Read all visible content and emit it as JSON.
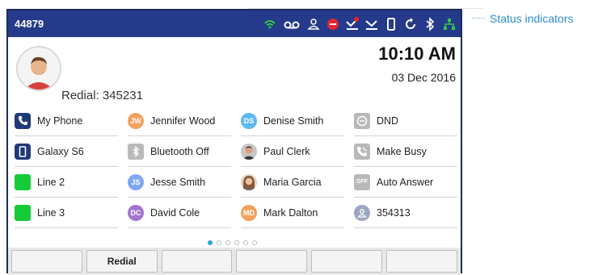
{
  "statusbar": {
    "extension": "44879",
    "icons": [
      "wifi-icon",
      "voicemail-icon",
      "presence-icon",
      "dnd-icon",
      "missed-call-icon",
      "call-forward-icon",
      "handset-icon",
      "sync-icon",
      "bluetooth-icon",
      "network-icon"
    ]
  },
  "home": {
    "redial_label": "Redial: 345231",
    "time": "10:10 AM",
    "date": "03 Dec 2016"
  },
  "keys": [
    {
      "label": "My Phone",
      "icon": "phone-icon",
      "type": "dark"
    },
    {
      "label": "Jennifer Wood",
      "icon": "initials",
      "initials": "JW",
      "color": "#f1a25e",
      "type": "circle"
    },
    {
      "label": "Denise Smith",
      "icon": "initials",
      "initials": "DS",
      "color": "#5fb8ef",
      "type": "circle"
    },
    {
      "label": "DND",
      "icon": "dnd-key-icon",
      "type": "gray"
    },
    {
      "label": "Galaxy S6",
      "icon": "mobile-icon",
      "type": "dark"
    },
    {
      "label": "Bluetooth Off",
      "icon": "bluetooth-icon",
      "type": "gray"
    },
    {
      "label": "Paul Clerk",
      "icon": "photo",
      "type": "photo"
    },
    {
      "label": "Make Busy",
      "icon": "make-busy-icon",
      "type": "gray"
    },
    {
      "label": "Line 2",
      "icon": "line-icon",
      "type": "green"
    },
    {
      "label": "Jesse Smith",
      "icon": "initials",
      "initials": "JS",
      "color": "#7fa7f3",
      "type": "circle"
    },
    {
      "label": "Maria Garcia",
      "icon": "photo",
      "type": "photo"
    },
    {
      "label": "Auto Answer",
      "icon": "auto-answer-icon",
      "initials": "OFF",
      "type": "gray"
    },
    {
      "label": "Line 3",
      "icon": "line-icon",
      "type": "green"
    },
    {
      "label": "David Cole",
      "icon": "initials",
      "initials": "DC",
      "color": "#a274cf",
      "type": "circle"
    },
    {
      "label": "Mark Dalton",
      "icon": "initials",
      "initials": "MD",
      "color": "#f1a25e",
      "type": "circle"
    },
    {
      "label": "354313",
      "icon": "contact-icon",
      "type": "gray-circle"
    }
  ],
  "page_indicator": {
    "count": 6,
    "active": 1
  },
  "softkeys": [
    "",
    "Redial",
    "",
    "",
    "",
    ""
  ],
  "callout": "Status indicators"
}
